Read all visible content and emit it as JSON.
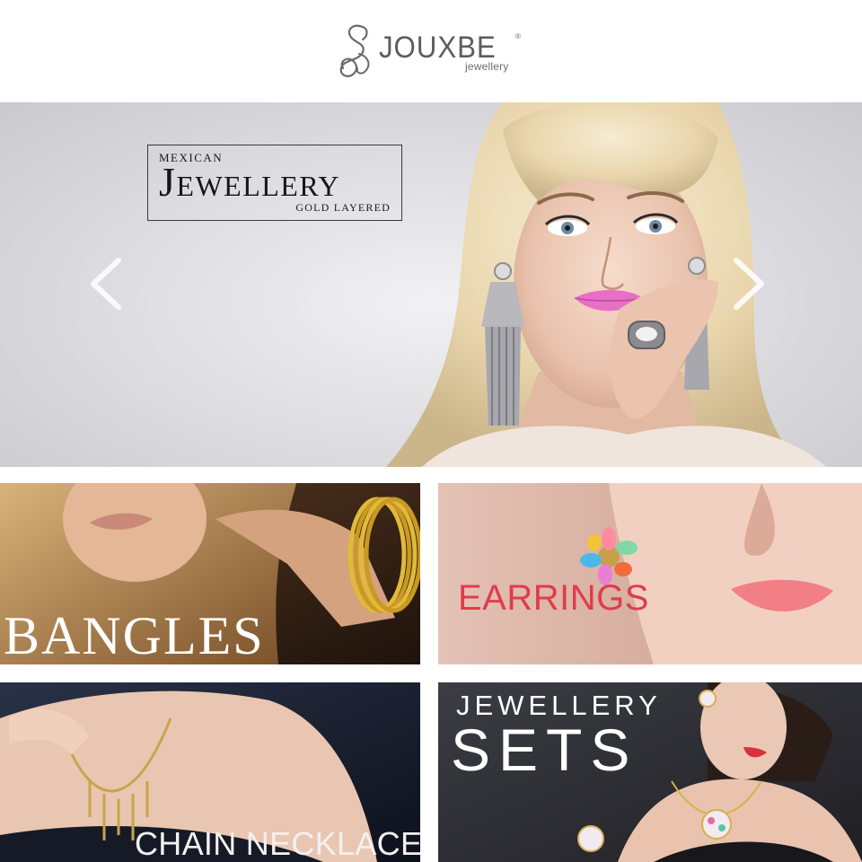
{
  "brand": {
    "name": "JOUXBE",
    "trademark": "®",
    "tagline": "jewellery",
    "logo_icon": "ampersand-swirl-icon"
  },
  "hero": {
    "badge_top": "MEXICAN",
    "badge_main": "Jewellery",
    "badge_bottom": "GOLD LAYERED",
    "prev_icon": "chevron-left-icon",
    "next_icon": "chevron-right-icon"
  },
  "categories": [
    {
      "label": "BANGLES",
      "label_color": "#ffffff"
    },
    {
      "label": "EARRINGS",
      "label_color": "#e13b4b"
    },
    {
      "label": "CHAIN NECKLACES",
      "label_color": "#f3f1ef"
    },
    {
      "label_line1": "JEWELLERY",
      "label_line2": "SETS",
      "label_color": "#ffffff"
    }
  ],
  "colors": {
    "logo_text": "#5d5d5d",
    "hero_background": "#dcdce0",
    "bangles_bg": "#2a1a10",
    "earrings_bg": "#dcb7aa",
    "necklaces_bg": "#141c2c",
    "sets_bg": "#2e2e34"
  }
}
